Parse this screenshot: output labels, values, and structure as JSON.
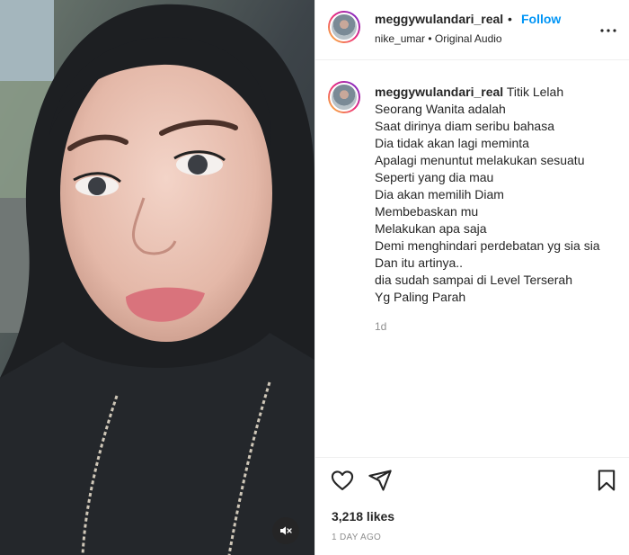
{
  "post": {
    "username": "meggywulandari_real",
    "separator": "•",
    "follow_label": "Follow",
    "audio_line": "nike_umar • Original Audio",
    "caption_lines": [
      "Titik Lelah",
      "Seorang Wanita adalah",
      "Saat dirinya diam seribu bahasa",
      "Dia tidak akan lagi meminta",
      "Apalagi menuntut melakukan sesuatu",
      "Seperti yang dia mau",
      "Dia akan memilih Diam",
      "Membebaskan mu",
      "Melakukan apa saja",
      "Demi menghindari perdebatan yg sia sia",
      "Dan itu artinya..",
      "dia sudah sampai di Level Terserah",
      "Yg Paling Parah"
    ],
    "relative_time": "1d",
    "likes": "3,218 likes",
    "date": "1 DAY AGO"
  },
  "icons": {
    "more": "more-options-icon",
    "heart": "heart-icon",
    "share": "share-icon",
    "save": "bookmark-icon",
    "mute": "muted-speaker-icon"
  }
}
